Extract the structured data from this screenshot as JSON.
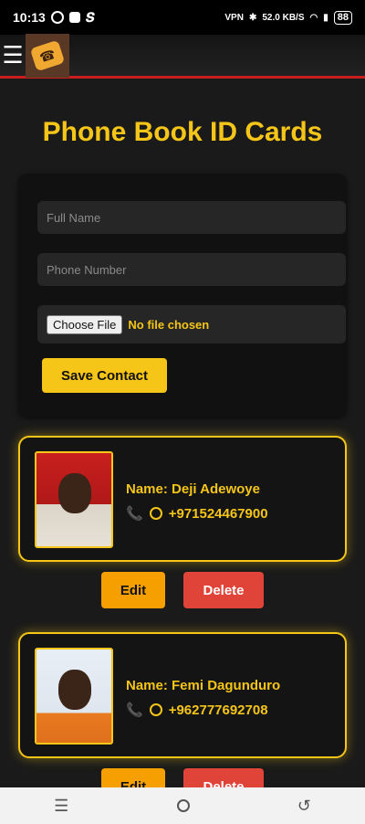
{
  "status_bar": {
    "time": "10:13",
    "net_speed_value": "52.0",
    "net_speed_unit": "KB/S",
    "battery": "88"
  },
  "header": {
    "menu_icon": "hamburger-menu-icon",
    "logo_icon": "phone-book-logo-icon"
  },
  "page": {
    "title": "Phone Book ID Cards"
  },
  "form": {
    "full_name_placeholder": "Full Name",
    "phone_placeholder": "Phone Number",
    "choose_file_label": "Choose File",
    "file_status": "No file chosen",
    "save_label": "Save Contact"
  },
  "contacts": [
    {
      "name": "Name: Deji Adewoye",
      "phone": "+971524467900",
      "edit_label": "Edit",
      "delete_label": "Delete"
    },
    {
      "name": "Name: Femi Dagunduro",
      "phone": "+962777692708",
      "edit_label": "Edit",
      "delete_label": "Delete"
    }
  ],
  "colors": {
    "accent": "#f5c518",
    "background": "#1a1a1a",
    "edit_button": "#f5a000",
    "delete_button": "#e04438",
    "header_border": "#c81e1e"
  }
}
